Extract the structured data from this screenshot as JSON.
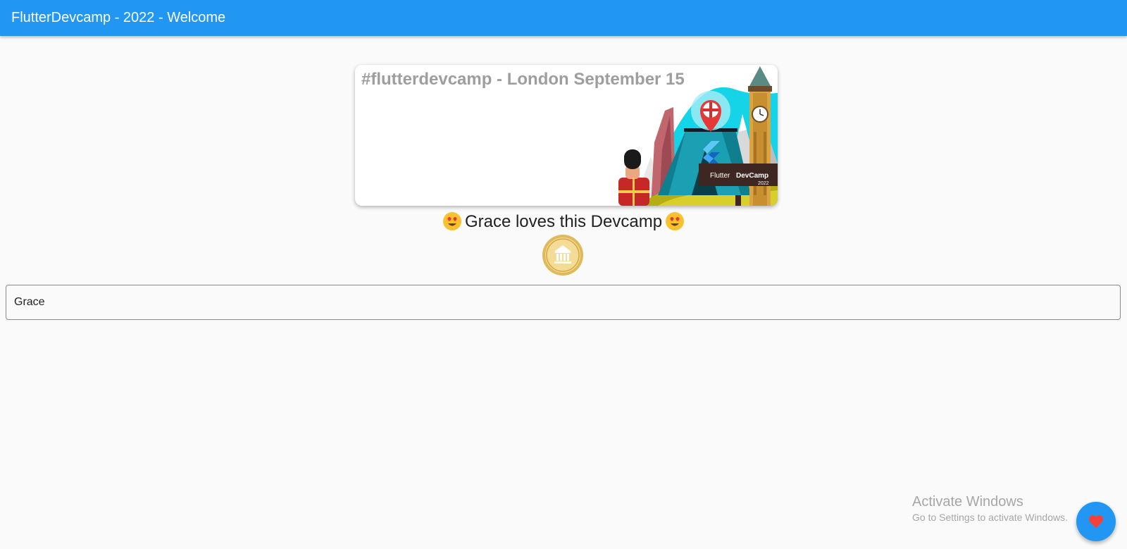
{
  "app_bar": {
    "title": "FlutterDevcamp - 2022 - Welcome",
    "color": "#2196f3"
  },
  "banner": {
    "title": "#flutterdevcamp - London September 15",
    "sign_text_1": "Flutter",
    "sign_text_2": "DevCamp",
    "sign_text_3": "2022",
    "illustration": "london-devcamp-illustration"
  },
  "love_line": {
    "emoji_left": "heart-eyes-emoji",
    "text": "Grace loves this Devcamp",
    "emoji_right": "heart-eyes-emoji"
  },
  "coin": {
    "icon": "gold-coin-icon"
  },
  "name_input": {
    "value": "Grace"
  },
  "watermark": {
    "title": "Activate Windows",
    "subtitle": "Go to Settings to activate Windows."
  },
  "fab": {
    "icon": "heart-icon",
    "color": "#2196f3",
    "icon_color": "#f44336"
  }
}
